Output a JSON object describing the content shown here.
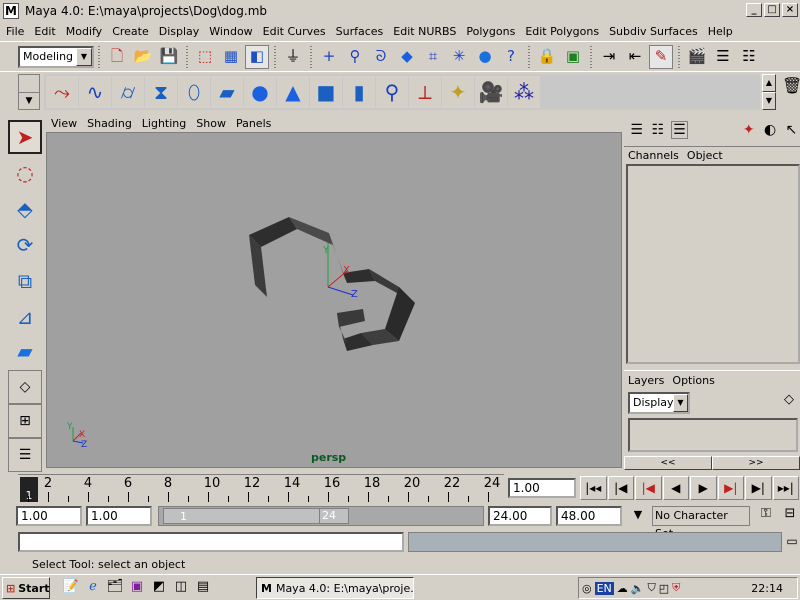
{
  "window": {
    "title": "Maya 4.0: E:\\maya\\projects\\Dog\\dog.mb",
    "app_icon": "M",
    "minimize_icon": "_",
    "maximize_icon": "□",
    "close_icon": "×"
  },
  "menu": [
    "File",
    "Edit",
    "Modify",
    "Create",
    "Display",
    "Window",
    "Edit Curves",
    "Surfaces",
    "Edit NURBS",
    "Polygons",
    "Edit Polygons",
    "Subdiv Surfaces",
    "Help"
  ],
  "status_line": {
    "mode": "Modeling"
  },
  "viewport": {
    "menu": [
      "View",
      "Shading",
      "Lighting",
      "Show",
      "Panels"
    ],
    "camera": "persp",
    "axis_labels": {
      "y": "Y",
      "x": "X",
      "z": "Z"
    }
  },
  "right_panel": {
    "channels_menu": [
      "Channels",
      "Object"
    ],
    "layers_menu": [
      "Layers",
      "Options"
    ],
    "layer_type": "Display",
    "nav_left": "<<",
    "nav_right": ">>"
  },
  "time_slider": {
    "current_frame": "1",
    "tick_labels": [
      "2",
      "4",
      "6",
      "8",
      "10",
      "12",
      "14",
      "16",
      "18",
      "20",
      "22",
      "24"
    ],
    "current_time_field": "1.00"
  },
  "range_slider": {
    "start_time": "1.00",
    "playback_start": "1.00",
    "range_start_label": "1",
    "range_end_label": "24",
    "playback_end": "24.00",
    "end_time": "48.00",
    "character_set": "No Character Set"
  },
  "help_line": "Select Tool: select an object",
  "taskbar": {
    "start": "Start",
    "task": "Maya 4.0: E:\\maya\\proje...",
    "lang": "EN",
    "clock": "22:14"
  },
  "colors": {
    "ui_gray": "#d4d0c8",
    "viewport_bg": "#a0a0a0",
    "camera_label": "#0a5a20"
  }
}
